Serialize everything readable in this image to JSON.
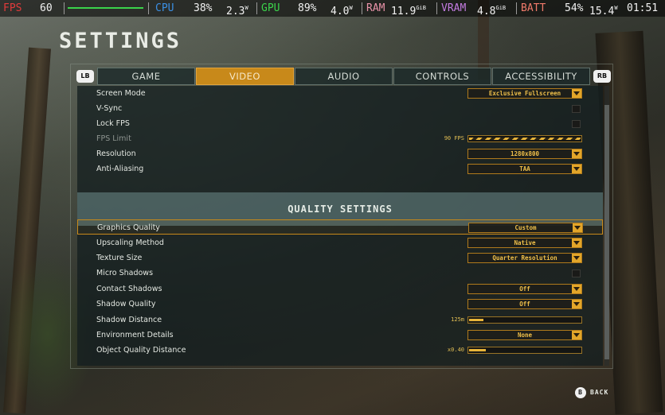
{
  "overlay": {
    "fps_label": "FPS",
    "fps_value": "60",
    "cpu_label": "CPU",
    "cpu_percent": "38%",
    "cpu_power": "2.3",
    "cpu_power_unit": "W",
    "gpu_label": "GPU",
    "gpu_percent": "89%",
    "gpu_power": "4.0",
    "gpu_power_unit": "W",
    "ram_label": "RAM",
    "ram_value": "11.9",
    "ram_unit": "GiB",
    "vram_label": "VRAM",
    "vram_value": "4.8",
    "vram_unit": "GiB",
    "batt_label": "BATT",
    "batt_percent": "54%",
    "batt_power": "15.4",
    "batt_power_unit": "W",
    "time": "01:51",
    "colors": {
      "fps": "#e23b3b",
      "cpu": "#3b8fe3",
      "gpu": "#3bd34b",
      "ram": "#e892a8",
      "vram": "#c27be0",
      "batt": "#f07a6a"
    }
  },
  "title": "SETTINGS",
  "nav": {
    "lb": "LB",
    "rb": "RB",
    "tabs": [
      "GAME",
      "VIDEO",
      "AUDIO",
      "CONTROLS",
      "ACCESSIBILITY"
    ],
    "active_tab": "VIDEO",
    "accent_color": "#c8891a"
  },
  "video": {
    "screen_mode": {
      "label": "Screen Mode",
      "value": "Exclusive Fullscreen"
    },
    "vsync": {
      "label": "V-Sync",
      "checked": false
    },
    "lock_fps": {
      "label": "Lock FPS",
      "checked": false
    },
    "fps_limit": {
      "label": "FPS Limit",
      "value": "90 FPS",
      "level": 1.0,
      "disabled": true
    },
    "resolution": {
      "label": "Resolution",
      "value": "1280x800"
    },
    "anti_aliasing": {
      "label": "Anti-Aliasing",
      "value": "TAA"
    }
  },
  "quality": {
    "header": "QUALITY SETTINGS",
    "graphics_quality": {
      "label": "Graphics Quality",
      "value": "Custom",
      "selected": true
    },
    "upscaling_method": {
      "label": "Upscaling Method",
      "value": "Native"
    },
    "texture_size": {
      "label": "Texture Size",
      "value": "Quarter Resolution"
    },
    "micro_shadows": {
      "label": "Micro Shadows",
      "checked": false
    },
    "contact_shadows": {
      "label": "Contact Shadows",
      "value": "Off"
    },
    "shadow_quality": {
      "label": "Shadow Quality",
      "value": "Off"
    },
    "shadow_distance": {
      "label": "Shadow Distance",
      "value": "125m",
      "level": 0.13
    },
    "environment_details": {
      "label": "Environment Details",
      "value": "None"
    },
    "object_quality_distance": {
      "label": "Object Quality Distance",
      "value": "x0.40",
      "level": 0.15
    }
  },
  "footer": {
    "back_button": "B",
    "back_label": "BACK"
  }
}
